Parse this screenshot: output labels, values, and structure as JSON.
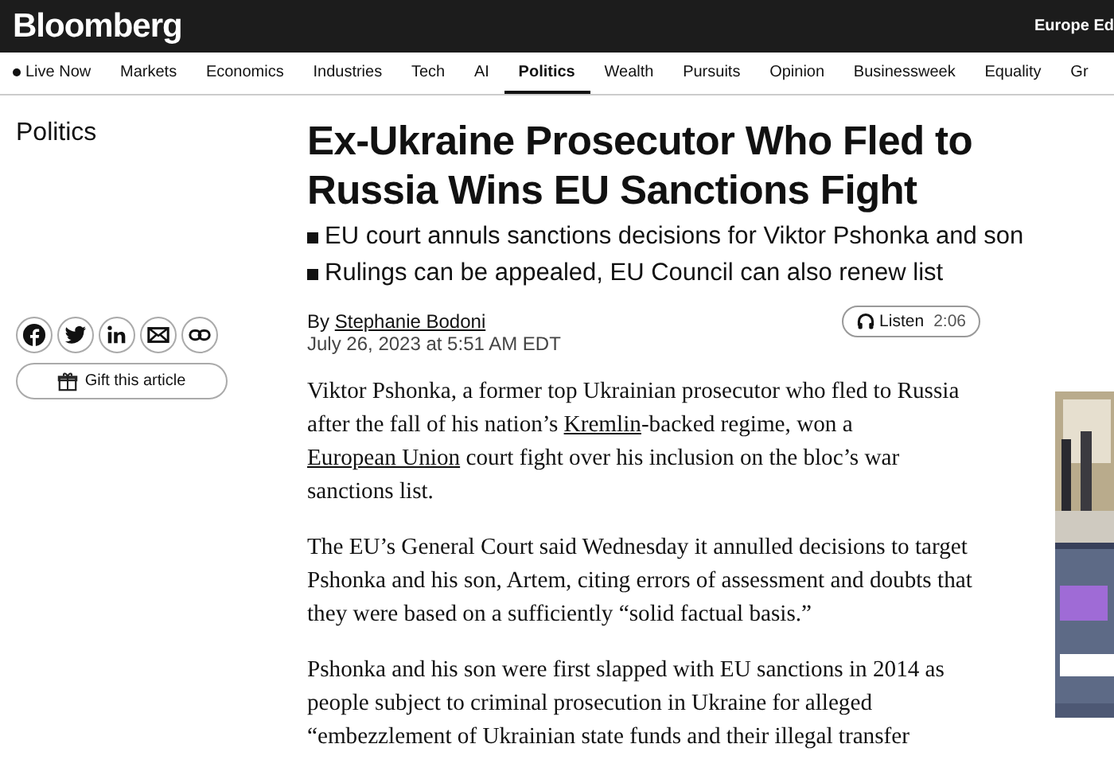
{
  "header": {
    "logo": "Bloomberg",
    "edition": "Europe Ed"
  },
  "nav": [
    {
      "label": "Live Now",
      "kind": "live",
      "selected": false
    },
    {
      "label": "Markets",
      "kind": "link",
      "selected": false
    },
    {
      "label": "Economics",
      "kind": "link",
      "selected": false
    },
    {
      "label": "Industries",
      "kind": "link",
      "selected": false
    },
    {
      "label": "Tech",
      "kind": "link",
      "selected": false
    },
    {
      "label": "AI",
      "kind": "link",
      "selected": false
    },
    {
      "label": "Politics",
      "kind": "link",
      "selected": true
    },
    {
      "label": "Wealth",
      "kind": "link",
      "selected": false
    },
    {
      "label": "Pursuits",
      "kind": "link",
      "selected": false
    },
    {
      "label": "Opinion",
      "kind": "link",
      "selected": false
    },
    {
      "label": "Businessweek",
      "kind": "link",
      "selected": false
    },
    {
      "label": "Equality",
      "kind": "link",
      "selected": false
    },
    {
      "label": "Gr",
      "kind": "link",
      "selected": false
    }
  ],
  "section": "Politics",
  "share": [
    {
      "kind": "facebook"
    },
    {
      "kind": "twitter"
    },
    {
      "kind": "linkedin"
    },
    {
      "kind": "email"
    },
    {
      "kind": "link"
    }
  ],
  "gift_button": "Gift this article",
  "article": {
    "headline": "Ex-Ukraine Prosecutor Who Fled to Russia Wins EU Sanctions Fight",
    "bullets": [
      "EU court annuls sanctions decisions for Viktor Pshonka and son",
      "Rulings can be appealed, EU Council can also renew list"
    ],
    "byline_prefix": "By",
    "author": "Stephanie Bodoni",
    "date": "July 26, 2023 at 5:51 AM EDT",
    "listen": {
      "label": "Listen",
      "duration": "2:06"
    },
    "paragraphs": [
      [
        {
          "text": "Viktor Pshonka, a former top Ukrainian prosecutor who fled to Russia after the fall of his nation’s ",
          "link": false
        },
        {
          "text": "Kremlin",
          "link": true
        },
        {
          "text": "-backed regime, won a ",
          "link": false
        },
        {
          "text": "European Union",
          "link": true
        },
        {
          "text": " court fight over his inclusion on the bloc’s war sanctions list.",
          "link": false
        }
      ],
      [
        {
          "text": "The EU’s General Court said Wednesday it annulled decisions to target Pshonka and his son, Artem, citing errors of assessment and doubts that they were based on a sufficiently “solid factual basis.”",
          "link": false
        }
      ],
      [
        {
          "text": "Pshonka and his son were first slapped with EU sanctions in 2014 as people subject to criminal prosecution in Ukraine for alleged “embezzlement of Ukrainian state funds and their illegal transfer",
          "link": false
        }
      ]
    ]
  }
}
